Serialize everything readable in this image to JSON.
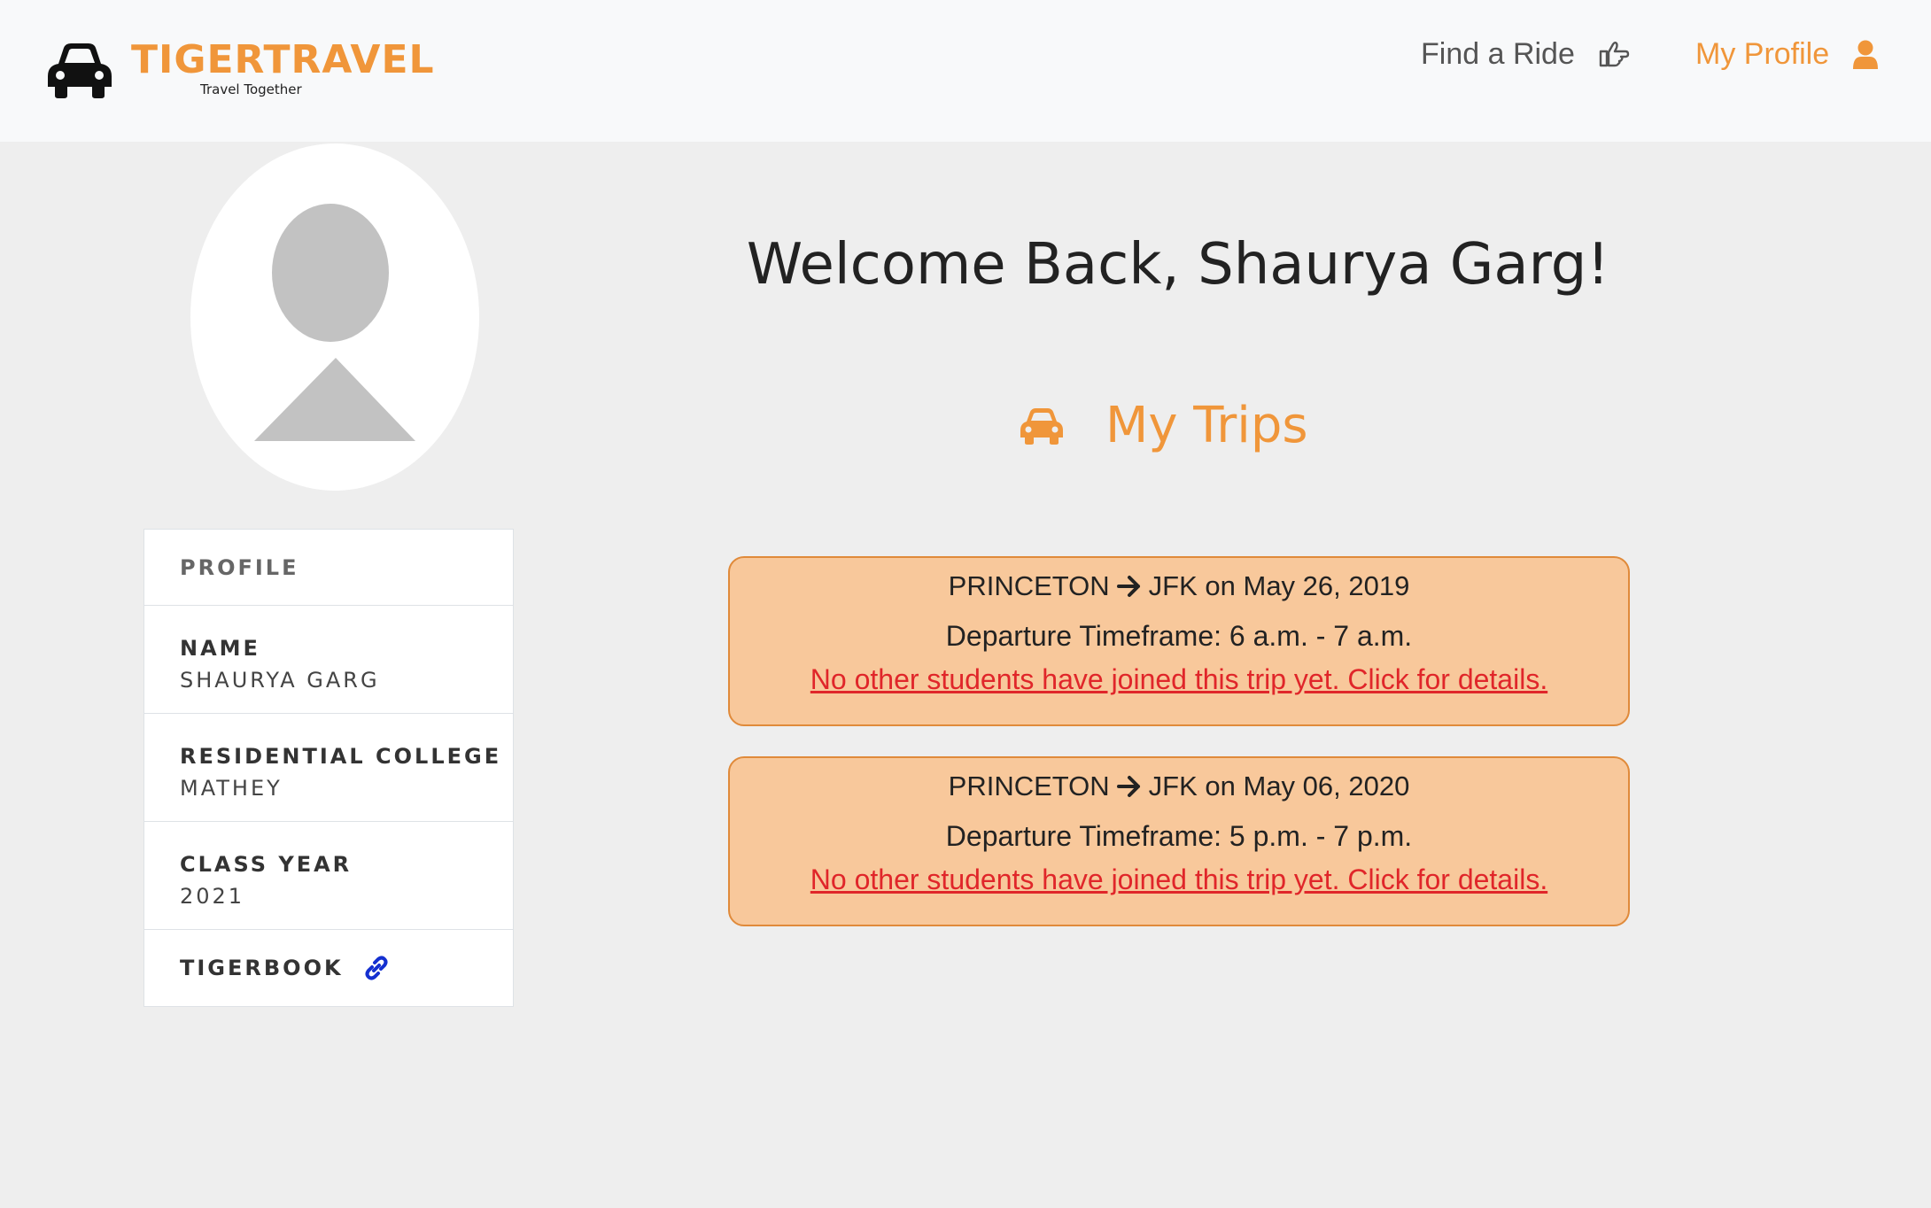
{
  "brand": {
    "title": "TIGERTRAVEL",
    "subtitle": "Travel Together"
  },
  "nav": {
    "find_ride": "Find a Ride",
    "my_profile": "My Profile"
  },
  "profile": {
    "header": "PROFILE",
    "name_label": "NAME",
    "name_value": "SHAURYA GARG",
    "college_label": "RESIDENTIAL COLLEGE",
    "college_value": "MATHEY",
    "year_label": "CLASS YEAR",
    "year_value": "2021",
    "tigerbook_label": "TIGERBOOK"
  },
  "main": {
    "welcome": "Welcome Back, Shaurya Garg!",
    "trips_heading": "My Trips",
    "trips": [
      {
        "from": "PRINCETON",
        "to": "JFK on May 26, 2019",
        "timeframe": "Departure Timeframe: 6 a.m. - 7 a.m.",
        "status": "No other students have joined this trip yet. Click for details."
      },
      {
        "from": "PRINCETON",
        "to": "JFK on May 06, 2020",
        "timeframe": "Departure Timeframe: 5 p.m. - 7 p.m.",
        "status": "No other students have joined this trip yet. Click for details."
      }
    ]
  },
  "colors": {
    "accent": "#f0963a",
    "trip_bg": "#f8c89b",
    "trip_border": "#e08a3a",
    "link_red": "#e0262a",
    "link_blue": "#1430d0"
  },
  "icons": {
    "brand": "car-icon",
    "find_ride": "hand-pointing-icon",
    "profile": "user-icon",
    "trips": "car-icon",
    "tigerbook": "link-icon",
    "route": "arrow-right-icon"
  }
}
